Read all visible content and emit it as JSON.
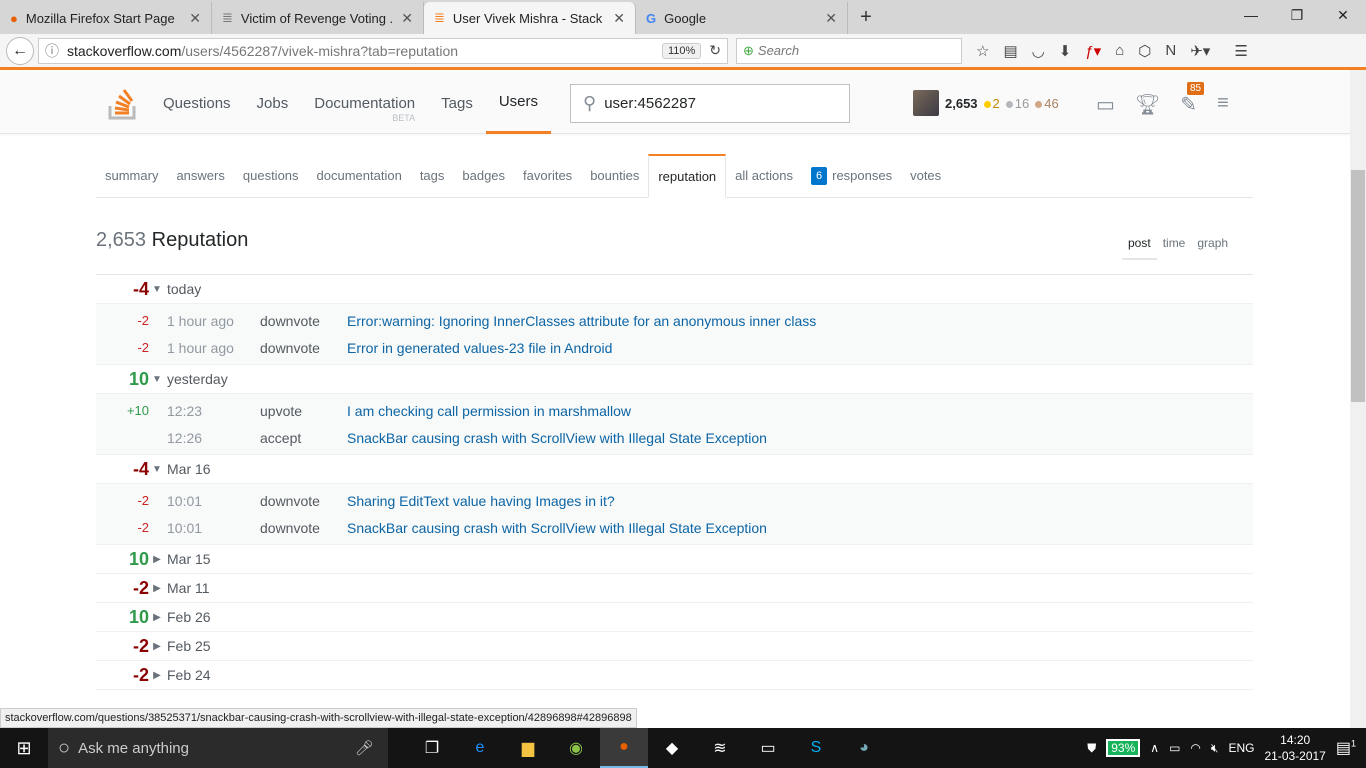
{
  "browser": {
    "tabs": [
      {
        "title": "Mozilla Firefox Start Page",
        "icon": "firefox-icon"
      },
      {
        "title": "Victim of Revenge Voting ...",
        "icon": "stackexchange-icon"
      },
      {
        "title": "User Vivek Mishra - Stack ...",
        "icon": "stackoverflow-icon",
        "active": true
      },
      {
        "title": "Google",
        "icon": "google-icon"
      }
    ],
    "url_domain": "stackoverflow.com",
    "url_path": "/users/4562287/vivek-mishra?tab=reputation",
    "zoom": "110%",
    "search_placeholder": "Search"
  },
  "so": {
    "nav": [
      "Questions",
      "Jobs",
      "Documentation",
      "Tags",
      "Users"
    ],
    "nav_active": "Users",
    "beta": "BETA",
    "search_value": "user:4562287",
    "user": {
      "rep": "2,653",
      "gold": "2",
      "silver": "16",
      "bronze": "46"
    },
    "inbox_badge": "85"
  },
  "profile": {
    "tabs": [
      "summary",
      "answers",
      "questions",
      "documentation",
      "tags",
      "badges",
      "favorites",
      "bounties",
      "reputation",
      "all actions",
      "responses",
      "votes"
    ],
    "active_tab": "reputation",
    "responses_count": "6",
    "rep_number": "2,653",
    "rep_label": "Reputation",
    "views": [
      "post",
      "time",
      "graph"
    ],
    "active_view": "post"
  },
  "groups": [
    {
      "amount": "-4",
      "label": "today",
      "expanded": true,
      "items": [
        {
          "amount": "-2",
          "time": "1 hour ago",
          "type": "downvote",
          "title": "Error:warning: Ignoring InnerClasses attribute for an anonymous inner class"
        },
        {
          "amount": "-2",
          "time": "1 hour ago",
          "type": "downvote",
          "title": "Error in generated values-23 file in Android"
        }
      ]
    },
    {
      "amount": "10",
      "label": "yesterday",
      "expanded": true,
      "items": [
        {
          "amount": "+10",
          "time": "12:23",
          "type": "upvote",
          "title": "I am checking call permission in marshmallow"
        },
        {
          "amount": "",
          "time": "12:26",
          "type": "accept",
          "title": "SnackBar causing crash with ScrollView with Illegal State Exception"
        }
      ]
    },
    {
      "amount": "-4",
      "label": "Mar 16",
      "expanded": true,
      "items": [
        {
          "amount": "-2",
          "time": "10:01",
          "type": "downvote",
          "title": "Sharing EditText value having Images in it?"
        },
        {
          "amount": "-2",
          "time": "10:01",
          "type": "downvote",
          "title": "SnackBar causing crash with ScrollView with Illegal State Exception"
        }
      ]
    },
    {
      "amount": "10",
      "label": "Mar 15",
      "expanded": false,
      "items": []
    },
    {
      "amount": "-2",
      "label": "Mar 11",
      "expanded": false,
      "items": []
    },
    {
      "amount": "10",
      "label": "Feb 26",
      "expanded": false,
      "items": []
    },
    {
      "amount": "-2",
      "label": "Feb 25",
      "expanded": false,
      "items": []
    },
    {
      "amount": "-2",
      "label": "Feb 24",
      "expanded": false,
      "items": []
    }
  ],
  "status_url": "stackoverflow.com/questions/38525371/snackbar-causing-crash-with-scrollview-with-illegal-state-exception/42896898#42896898",
  "taskbar": {
    "search": "Ask me anything",
    "battery": "93%",
    "lang": "ENG",
    "time": "14:20",
    "date": "21-03-2017",
    "notifications": "1"
  },
  "colors": {
    "accent": "#f48024",
    "link": "#0c65a5",
    "negative": "#8b0000",
    "positive": "#2f9a4a"
  }
}
